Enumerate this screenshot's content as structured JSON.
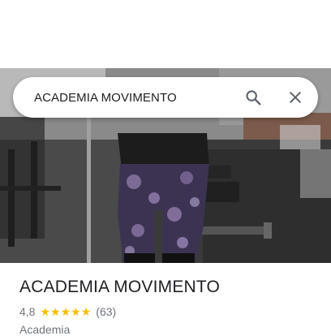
{
  "search": {
    "query": "ACADEMIA MOVIMENTO",
    "search_icon": "search-icon",
    "clear_icon": "close-icon"
  },
  "photo": {
    "subject": "gym-photo"
  },
  "place": {
    "name": "ACADEMIA MOVIMENTO",
    "rating": "4,8",
    "rating_value": 4.8,
    "stars_shown": 5,
    "star_glyph": "★",
    "review_count": "(63)",
    "category": "Academia"
  },
  "colors": {
    "star": "#fbbc04",
    "text_primary": "#202124",
    "text_secondary": "#70757a"
  }
}
